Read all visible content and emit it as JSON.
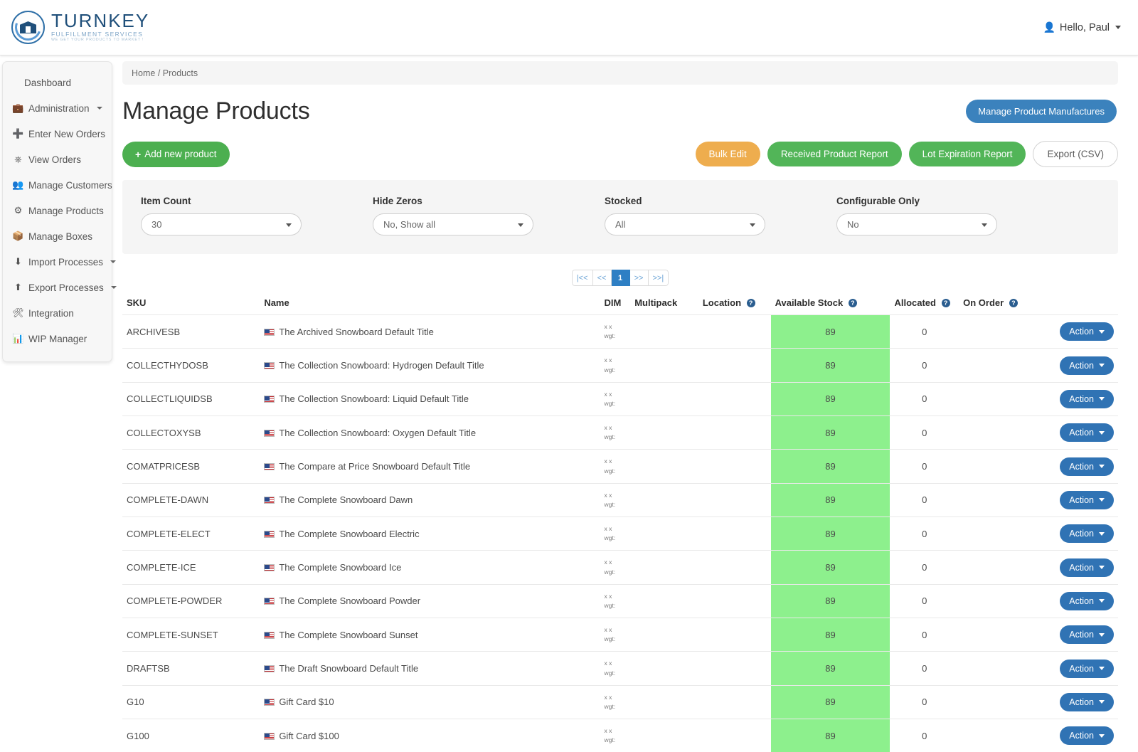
{
  "topbar": {
    "brand_name": "TURNKEY",
    "brand_tagline": "FULFILLMENT SERVICES",
    "brand_tagline2": "WE GET YOUR PRODUCTS TO MARKET !",
    "user_greeting": "Hello, Paul"
  },
  "sidebar": {
    "items": [
      {
        "label": "Dashboard",
        "icon": "",
        "caret": false
      },
      {
        "label": "Administration",
        "icon": "briefcase-icon",
        "glyph": "ὋC",
        "caret": true
      },
      {
        "label": "Enter New Orders",
        "icon": "plus-icon",
        "caret": false
      },
      {
        "label": "View Orders",
        "icon": "inbox-icon",
        "caret": false
      },
      {
        "label": "Manage Customers",
        "icon": "users-icon",
        "caret": false
      },
      {
        "label": "Manage Products",
        "icon": "gear-icon",
        "caret": false
      },
      {
        "label": "Manage Boxes",
        "icon": "box-icon",
        "caret": false
      },
      {
        "label": "Import Processes",
        "icon": "download-icon",
        "caret": true
      },
      {
        "label": "Export Processes",
        "icon": "upload-icon",
        "caret": true
      },
      {
        "label": "Integration",
        "icon": "wand-icon",
        "caret": false
      },
      {
        "label": "WIP Manager",
        "icon": "chart-icon",
        "caret": false
      }
    ]
  },
  "main": {
    "breadcrumb": "Home / Products",
    "page_title": "Manage Products",
    "manage_manufactures_label": "Manage Product Manufactures",
    "add_product_label": "Add new product",
    "bulk_edit_label": "Bulk Edit",
    "received_report_label": "Received Product Report",
    "lot_expiration_label": "Lot Expiration Report",
    "export_csv_label": "Export (CSV)"
  },
  "filters": [
    {
      "label": "Item Count",
      "value": "30"
    },
    {
      "label": "Hide Zeros",
      "value": "No, Show all"
    },
    {
      "label": "Stocked",
      "value": "All"
    },
    {
      "label": "Configurable Only",
      "value": "No"
    }
  ],
  "pagination": {
    "first": "|<<",
    "prev": "<<",
    "current": "1",
    "next": ">>",
    "last": ">>|"
  },
  "table": {
    "headers": [
      {
        "label": "SKU",
        "help": false
      },
      {
        "label": "Name",
        "help": false
      },
      {
        "label": "DIM",
        "help": false
      },
      {
        "label": "Multipack",
        "help": false
      },
      {
        "label": "Location",
        "help": true
      },
      {
        "label": "Available Stock",
        "help": true
      },
      {
        "label": "Allocated",
        "help": true
      },
      {
        "label": "On Order",
        "help": true
      },
      {
        "label": "",
        "help": false
      }
    ],
    "help_glyph": "?",
    "dim_line1": "x x",
    "dim_line2": "wgt:",
    "action_label": "Action",
    "rows": [
      {
        "sku": "ARCHIVESB",
        "name": "The Archived Snowboard Default Title",
        "multipack": "",
        "location": "",
        "stock": "89",
        "allocated": "0",
        "on_order": ""
      },
      {
        "sku": "COLLECTHYDOSB",
        "name": "The Collection Snowboard: Hydrogen Default Title",
        "multipack": "",
        "location": "",
        "stock": "89",
        "allocated": "0",
        "on_order": ""
      },
      {
        "sku": "COLLECTLIQUIDSB",
        "name": "The Collection Snowboard: Liquid Default Title",
        "multipack": "",
        "location": "",
        "stock": "89",
        "allocated": "0",
        "on_order": ""
      },
      {
        "sku": "COLLECTOXYSB",
        "name": "The Collection Snowboard: Oxygen Default Title",
        "multipack": "",
        "location": "",
        "stock": "89",
        "allocated": "0",
        "on_order": ""
      },
      {
        "sku": "COMATPRICESB",
        "name": "The Compare at Price Snowboard Default Title",
        "multipack": "",
        "location": "",
        "stock": "89",
        "allocated": "0",
        "on_order": ""
      },
      {
        "sku": "COMPLETE-DAWN",
        "name": "The Complete Snowboard Dawn",
        "multipack": "",
        "location": "",
        "stock": "89",
        "allocated": "0",
        "on_order": ""
      },
      {
        "sku": "COMPLETE-ELECT",
        "name": "The Complete Snowboard Electric",
        "multipack": "",
        "location": "",
        "stock": "89",
        "allocated": "0",
        "on_order": ""
      },
      {
        "sku": "COMPLETE-ICE",
        "name": "The Complete Snowboard Ice",
        "multipack": "",
        "location": "",
        "stock": "89",
        "allocated": "0",
        "on_order": ""
      },
      {
        "sku": "COMPLETE-POWDER",
        "name": "The Complete Snowboard Powder",
        "multipack": "",
        "location": "",
        "stock": "89",
        "allocated": "0",
        "on_order": ""
      },
      {
        "sku": "COMPLETE-SUNSET",
        "name": "The Complete Snowboard Sunset",
        "multipack": "",
        "location": "",
        "stock": "89",
        "allocated": "0",
        "on_order": ""
      },
      {
        "sku": "DRAFTSB",
        "name": "The Draft Snowboard Default Title",
        "multipack": "",
        "location": "",
        "stock": "89",
        "allocated": "0",
        "on_order": ""
      },
      {
        "sku": "G10",
        "name": "Gift Card $10",
        "multipack": "",
        "location": "",
        "stock": "89",
        "allocated": "0",
        "on_order": ""
      },
      {
        "sku": "G100",
        "name": "Gift Card $100",
        "multipack": "",
        "location": "",
        "stock": "89",
        "allocated": "0",
        "on_order": ""
      }
    ]
  },
  "colors": {
    "brand_blue": "#1f4f7a",
    "primary_blue": "#3b82bd",
    "green": "#4caf50",
    "orange": "#eead4e",
    "stock_green": "#8df08d",
    "action_blue": "#3073b4"
  }
}
